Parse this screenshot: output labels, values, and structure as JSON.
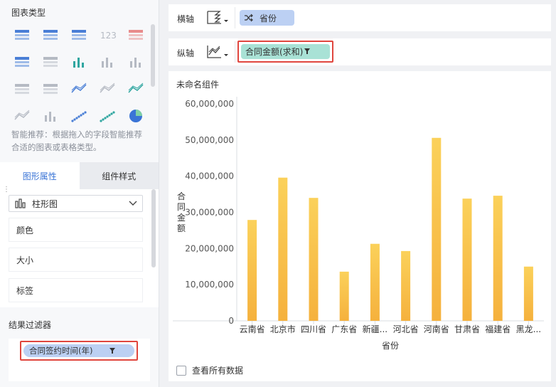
{
  "left_panel": {
    "chart_types_title": "图表类型",
    "chart_type_icons": [
      "table-icon",
      "cross-table-icon",
      "detail-table-icon",
      "kpi-icon",
      "grouped-table-icon",
      "card-icon",
      "map-icon",
      "stacked-bar-icon",
      "bar-icon",
      "column-icon",
      "heatmap-icon",
      "waterfall-icon",
      "multi-line-icon",
      "line-icon",
      "radar-icon",
      "area-icon",
      "bar-small-icon",
      "scatter-icon",
      "bubble-icon",
      "pie-icon"
    ],
    "hint": "智能推荐：根据拖入的字段智能推荐合适的图表或表格类型。",
    "tabs": {
      "graph_props": "图形属性",
      "component_style": "组件样式"
    },
    "chart_type_select": "柱形图",
    "props": {
      "color": "颜色",
      "size": "大小",
      "label": "标签"
    },
    "result_filter_title": "结果过滤器",
    "filter_pill": "合同签约时间(年)"
  },
  "shelves": {
    "x_label": "横轴",
    "x_pill": "省份",
    "y_label": "纵轴",
    "y_pill": "合同金额(求和)"
  },
  "chart_card": {
    "widget_title": "未命名组件",
    "show_all_label": "查看所有数据"
  },
  "colors": {
    "bar_top": "#fbd15a",
    "bar_bottom": "#f5b13d",
    "accent": "#3a74d6",
    "highlight": "#e0463e"
  },
  "chart_data": {
    "type": "bar",
    "title": "",
    "xlabel": "省份",
    "ylabel": "合同金额",
    "categories": [
      "云南省",
      "北京市",
      "四川省",
      "广东省",
      "新疆...",
      "河北省",
      "河南省",
      "甘肃省",
      "福建省",
      "黑龙..."
    ],
    "values": [
      27900000,
      39600000,
      34000000,
      13600000,
      21300000,
      19300000,
      50600000,
      33800000,
      34600000,
      15000000
    ],
    "ylim": [
      0,
      60000000
    ],
    "yticks": [
      "60,000,000",
      "50,000,000",
      "40,000,000",
      "30,000,000",
      "20,000,000",
      "10,000,000",
      "0"
    ],
    "ytick_values": [
      60000000,
      50000000,
      40000000,
      30000000,
      20000000,
      10000000,
      0
    ],
    "grid": false,
    "legend": "none"
  }
}
